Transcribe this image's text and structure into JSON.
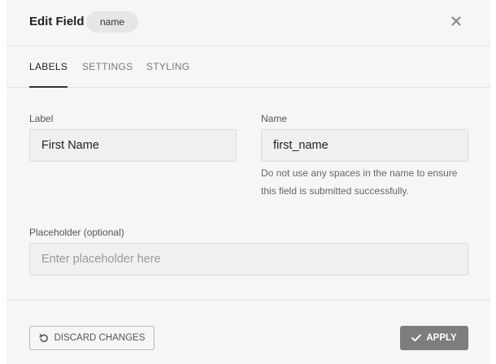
{
  "header": {
    "title": "Edit Field",
    "pill": "name",
    "close_icon": "close-icon"
  },
  "tabs": [
    {
      "label": "LABELS",
      "active": true
    },
    {
      "label": "SETTINGS",
      "active": false
    },
    {
      "label": "STYLING",
      "active": false
    }
  ],
  "fields": {
    "label": {
      "caption": "Label",
      "value": "First Name"
    },
    "name": {
      "caption": "Name",
      "value": "first_name",
      "help": "Do not use any spaces in the name to ensure this field is submitted successfully."
    },
    "placeholder": {
      "caption": "Placeholder (optional)",
      "value": "",
      "placeholder": "Enter placeholder here"
    }
  },
  "footer": {
    "discard_label": "DISCARD CHANGES",
    "discard_icon": "undo-icon",
    "apply_label": "APPLY",
    "apply_icon": "check-icon"
  },
  "colors": {
    "background": "#f6f6f6",
    "input_bg": "#f0f0f0",
    "apply_bg": "#7d7d7d",
    "active_tab_underline": "#333333"
  }
}
